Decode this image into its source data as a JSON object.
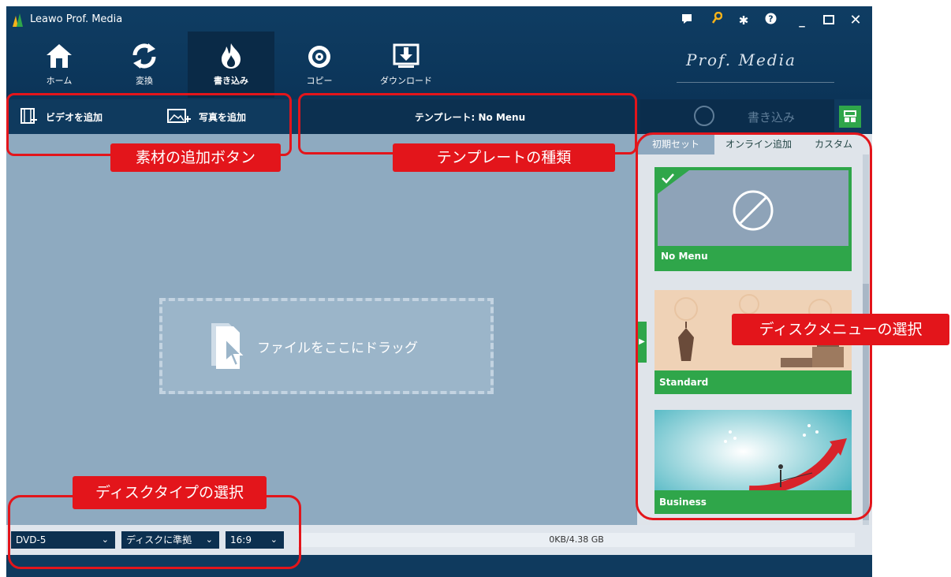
{
  "app": {
    "title": "Leawo Prof. Media",
    "brand": "Prof. Media",
    "window_controls": [
      "chat-icon",
      "key-icon",
      "gear-icon",
      "help-icon",
      "minimize-icon",
      "maximize-icon",
      "close-icon"
    ]
  },
  "nav": {
    "tabs": [
      {
        "label": "ホーム",
        "icon": "home-icon"
      },
      {
        "label": "変換",
        "icon": "convert-icon"
      },
      {
        "label": "書き込み",
        "icon": "burn-icon"
      },
      {
        "label": "コピー",
        "icon": "copy-icon"
      },
      {
        "label": "ダウンロード",
        "icon": "download-icon"
      }
    ]
  },
  "toolbar": {
    "add_video": "ビデオを追加",
    "add_photo": "写真を追加",
    "template": "テンプレート: No Menu",
    "burn": "書き込み"
  },
  "content": {
    "drop_text": "ファイルをここにドラッグ"
  },
  "panel": {
    "tabs": [
      "初期セット",
      "オンライン追加",
      "カスタム"
    ],
    "menus": [
      {
        "name": "No Menu",
        "selected": true
      },
      {
        "name": "Standard",
        "selected": false
      },
      {
        "name": "Business",
        "selected": false
      }
    ]
  },
  "status": {
    "disc_type": "DVD-5",
    "quality": "ディスクに準拠",
    "aspect": "16:9",
    "capacity": "0KB/4.38 GB"
  },
  "annotations": {
    "add_buttons": "素材の追加ボタン",
    "template_type": "テンプレートの種類",
    "disc_menu": "ディスクメニューの選択",
    "disc_type": "ディスクタイプの選択"
  },
  "colors": {
    "accent_green": "#2fa64a",
    "annotation_red": "#e3151b",
    "title_bar": "#0f3d63"
  }
}
